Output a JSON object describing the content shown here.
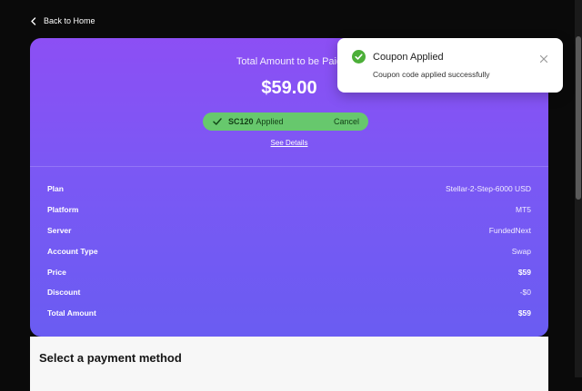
{
  "nav": {
    "back_label": "Back to Home"
  },
  "summary": {
    "total_label": "Total Amount to be Paid",
    "total_amount": "$59.00",
    "coupon": {
      "code": "SC120",
      "status": "Applied",
      "cancel_label": "Cancel"
    },
    "see_details_label": "See Details"
  },
  "details": [
    {
      "label": "Plan",
      "value": "Stellar-2-Step-6000 USD"
    },
    {
      "label": "Platform",
      "value": "MT5"
    },
    {
      "label": "Server",
      "value": "FundedNext"
    },
    {
      "label": "Account Type",
      "value": "Swap"
    },
    {
      "label": "Price",
      "value": "$59"
    },
    {
      "label": "Discount",
      "value": "-$0"
    },
    {
      "label": "Total Amount",
      "value": "$59"
    }
  ],
  "payment": {
    "title": "Select a payment method"
  },
  "toast": {
    "title": "Coupon Applied",
    "message": "Coupon code applied successfully"
  },
  "colors": {
    "card_gradient_top": "#8c4ff4",
    "card_gradient_bottom": "#6a5cf2",
    "coupon_green": "#67c86d",
    "toast_icon_green": "#4caf38"
  }
}
